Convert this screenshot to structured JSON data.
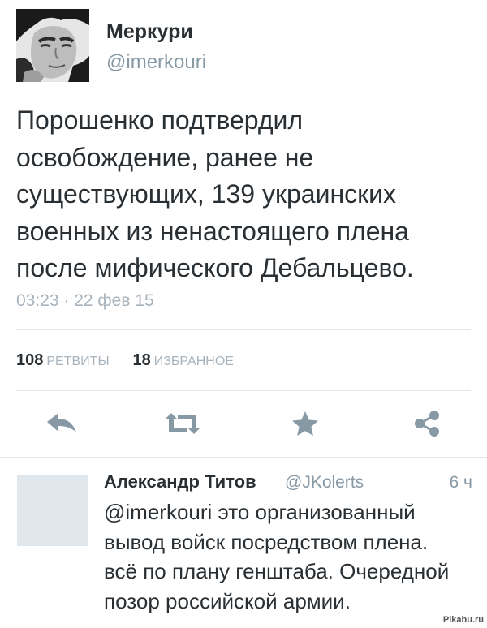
{
  "tweet": {
    "author_name": "Меркури",
    "author_handle": "@imerkouri",
    "text_lines": [
      "Порошенко подтвердил",
      "освобождение, ранее не",
      "существующих, 139 украинских",
      "военных из ненастоящего плена",
      "после мифического Дебальцево."
    ],
    "timestamp": "03:23 · 22 фев 15",
    "stats": {
      "retweets_count": "108",
      "retweets_label": "РЕТВИТЫ",
      "favorites_count": "18",
      "favorites_label": "ИЗБРАННОЕ"
    },
    "actions": [
      {
        "icon": "reply-icon"
      },
      {
        "icon": "retweet-icon"
      },
      {
        "icon": "star-icon"
      },
      {
        "icon": "share-icon"
      }
    ],
    "colors": {
      "icon": "#8899a6",
      "text": "#292f33",
      "muted": "#a8b3bc",
      "divider": "#e1e8ed"
    }
  },
  "reply": {
    "author_name": "Александр Титов",
    "author_handle": "@JKolerts",
    "time": "6 ч",
    "text_lines": [
      "@imerkouri это организованный",
      "вывод войск посредством плена.",
      "всё по плану генштаба. Очередной",
      "позор российской армии."
    ]
  },
  "watermark": {
    "text": "Pikabu.ru"
  }
}
